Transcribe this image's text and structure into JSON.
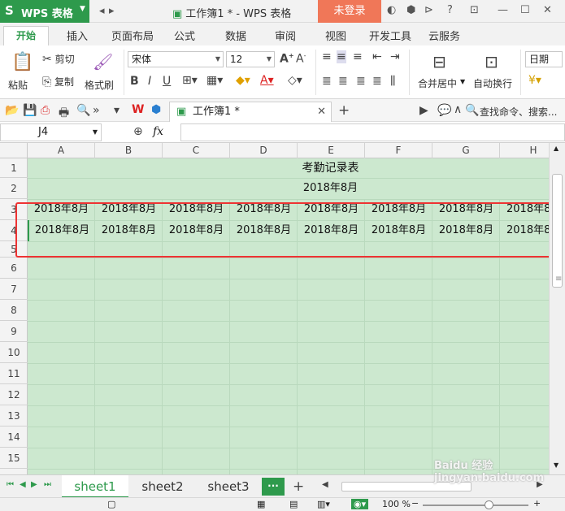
{
  "app": {
    "menu_button": "WPS 表格",
    "window_title": "工作簿1 * - WPS 表格",
    "login": "未登录"
  },
  "tabs": [
    "开始",
    "插入",
    "页面布局",
    "公式",
    "数据",
    "审阅",
    "视图",
    "开发工具",
    "云服务"
  ],
  "ribbon": {
    "paste": "粘贴",
    "cut": "剪切",
    "copy": "复制",
    "format_painter": "格式刷",
    "font_name": "宋体",
    "font_size": "12",
    "merge_center": "合并居中",
    "wrap_text": "自动换行",
    "number_format": "日期"
  },
  "quickbar": {
    "doc_tab": "工作簿1 *",
    "search": "查找命令、搜索..."
  },
  "formula_bar": {
    "name_box": "J4",
    "fx": "fx",
    "value": ""
  },
  "grid": {
    "columns": [
      "A",
      "B",
      "C",
      "D",
      "E",
      "F",
      "G",
      "H"
    ],
    "rows": [
      "1",
      "2",
      "3",
      "4",
      "5",
      "6",
      "7",
      "8",
      "9",
      "10",
      "11",
      "12",
      "13",
      "14",
      "15"
    ],
    "row1_text": "考勤记录表",
    "row2_text": "2018年8月",
    "row3": [
      "2018年8月",
      "2018年8月",
      "2018年8月",
      "2018年8月",
      "2018年8月",
      "2018年8月",
      "2018年8月",
      "2018年8"
    ],
    "row4": [
      "2018年8月",
      "2018年8月",
      "2018年8月",
      "2018年8月",
      "2018年8月",
      "2018年8月",
      "2018年8月",
      "2018年8"
    ]
  },
  "sheets": [
    "sheet1",
    "sheet2",
    "sheet3"
  ],
  "status": {
    "zoom": "100 %"
  },
  "watermark": "Baidu 经验 jingyan.baidu.com"
}
